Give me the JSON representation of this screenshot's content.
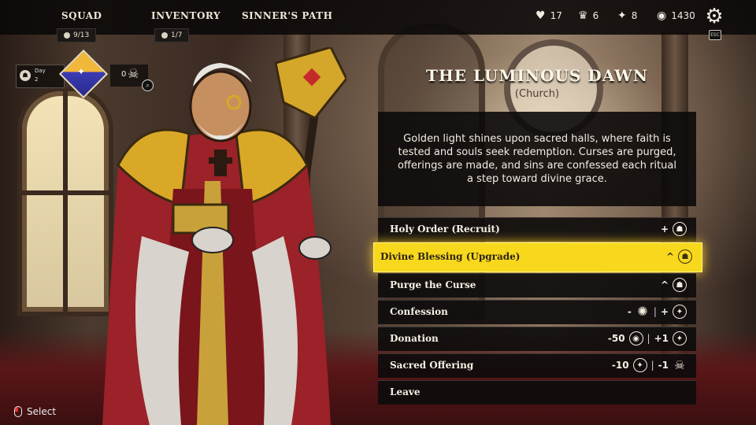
{
  "nav": {
    "tabs": [
      {
        "label": "SQUAD",
        "badge": "9/13"
      },
      {
        "label": "INVENTORY",
        "badge": "1/7"
      },
      {
        "label": "SINNER'S PATH"
      }
    ]
  },
  "stats": {
    "health": "17",
    "crowns": "6",
    "compass": "8",
    "coins": "1430"
  },
  "esc_label": "ESC",
  "day": {
    "label": "Day",
    "value": "2"
  },
  "skull_count": "0",
  "event": {
    "title": "THE LUMINOUS DAWN",
    "subtitle": "(Church)",
    "description": "Golden light shines upon sacred halls, where faith is tested and souls seek redemption. Curses are purged, offerings are made, and sins are confessed each ritual a step toward divine grace."
  },
  "options": [
    {
      "label": "Holy Order (Recruit)",
      "right": "+",
      "icon": "recruit-icon"
    },
    {
      "label": "Divine Blessing (Upgrade)",
      "right": "^",
      "icon": "upgrade-icon",
      "selected": true
    },
    {
      "label": "Purge the Curse",
      "right": "^",
      "icon": "curse-purge-icon"
    },
    {
      "label": "Confession",
      "cost": "-",
      "cost_icon": "sun-icon",
      "gain": "+",
      "gain_icon": "compass-icon"
    },
    {
      "label": "Donation",
      "cost": "-50",
      "cost_icon": "coin-icon",
      "gain": "+1",
      "gain_icon": "compass-icon"
    },
    {
      "label": "Sacred Offering",
      "cost": "-10",
      "cost_icon": "compass-icon",
      "gain": "-1",
      "gain_icon": "demon-icon"
    },
    {
      "label": "Leave"
    }
  ],
  "hint": {
    "label": "Select"
  },
  "colors": {
    "highlight": "#f8d81c",
    "panel": "#0e0c0c",
    "text": "#f5f1e6"
  }
}
